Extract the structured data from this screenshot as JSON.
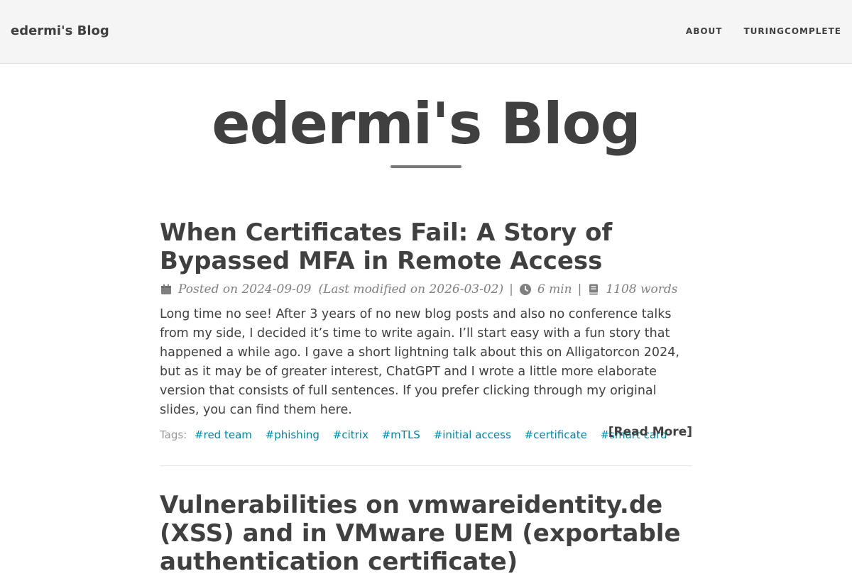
{
  "nav": {
    "brand": "edermi's Blog",
    "links": [
      {
        "label": "ABOUT"
      },
      {
        "label": "TURINGCOMPLETE"
      }
    ]
  },
  "header": {
    "title": "edermi's Blog"
  },
  "posts": [
    {
      "title": "When Certificates Fail: A Story of Bypassed MFA in Remote Access",
      "posted": "Posted on 2024-09-09",
      "modified": "(Last modified on 2026-03-02)",
      "reading_time": "6 min",
      "word_count": "1108 words",
      "excerpt": "Long time no see! After 3 years of no new blog posts and also no conference talks from my side, I decided it’s time to write again. I’ll start easy with a fun story that happened a while ago. I gave a short lightning talk about this on Alligatorcon 2024, but as it may be of greater interest, ChatGPT and I wrote a little more elaborate version that consists of full sentences. If you prefer clicking through my original slides, you can find them here.",
      "tags_label": "Tags:",
      "tags": [
        "#red team",
        "#phishing",
        "#citrix",
        "#mTLS",
        "#initial access",
        "#certificate",
        "#smart card"
      ],
      "read_more": "[Read More]"
    },
    {
      "title": "Vulnerabilities on vmwareidentity.de (XSS) and in VMware UEM (exportable authentication certificate)"
    }
  ],
  "icons": {
    "posted": "calendar-icon",
    "reading_time": "clock-icon",
    "word_count": "book-icon"
  },
  "colors": {
    "accent": "#0085a1",
    "text": "#404040",
    "muted": "#808080",
    "navbar_bg": "#f5f5f5"
  }
}
